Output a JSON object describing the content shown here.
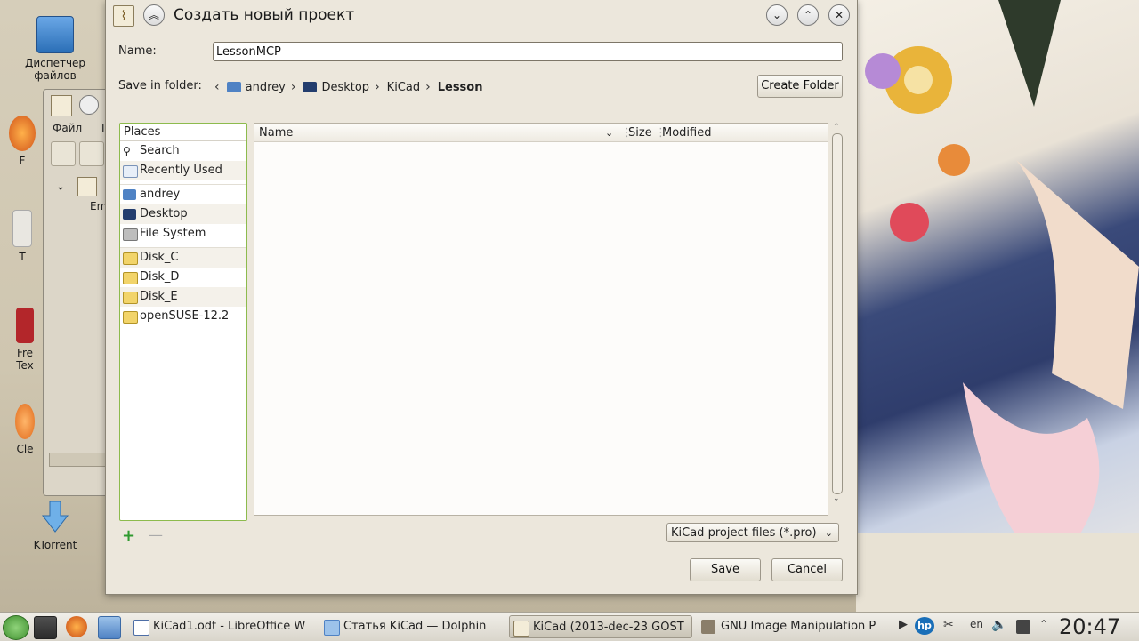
{
  "desktop": {
    "icons": [
      {
        "label": "Диспетчер\nфайлов"
      },
      {
        "label": "F"
      },
      {
        "label": "T"
      },
      {
        "label": "Fre\nTex"
      },
      {
        "label": "Cle"
      },
      {
        "label": "KTorrent"
      }
    ],
    "bg_window": {
      "menu_items": [
        "Файл",
        "П"
      ],
      "tree_label": "Em"
    }
  },
  "dialog": {
    "title": "Создать новый проект",
    "name_label": "Name:",
    "name_value": "LessonMCP",
    "save_in_label": "Save in folder:",
    "breadcrumbs": [
      "andrey",
      "Desktop",
      "KiCad",
      "Lesson"
    ],
    "create_folder_label": "Create Folder",
    "places": {
      "header": "Places",
      "groups": [
        [
          "Search",
          "Recently Used"
        ],
        [
          "andrey",
          "Desktop",
          "File System"
        ],
        [
          "Disk_C",
          "Disk_D",
          "Disk_E",
          "openSUSE-12.2"
        ]
      ]
    },
    "file_list": {
      "columns": [
        "Name",
        "Size",
        "Modified"
      ]
    },
    "filter_value": "KiCad project files (*.pro)",
    "save_label": "Save",
    "cancel_label": "Cancel"
  },
  "taskbar": {
    "tasks": [
      "KiCad1.odt - LibreOffice W",
      "Статья KiCad — Dolphin",
      "KiCad (2013-dec-23 GOST",
      "GNU Image Manipulation P"
    ],
    "keyboard_layout": "en",
    "clock": "20:47"
  },
  "colors": {
    "places_border": "#8dbb4d",
    "dialog_bg": "#ece7dc"
  }
}
